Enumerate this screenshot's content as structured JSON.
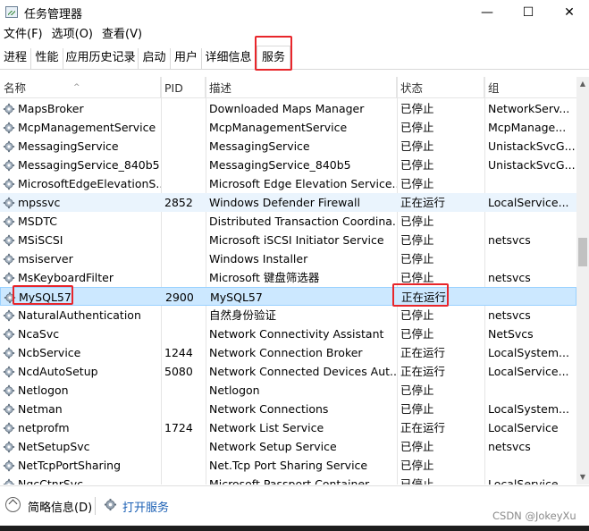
{
  "window": {
    "title": "任务管理器",
    "minimize_glyph": "—",
    "maximize_glyph": "☐",
    "close_glyph": "✕"
  },
  "menu": [
    "文件(F)",
    "选项(O)",
    "查看(V)"
  ],
  "tabs": [
    {
      "label": "进程"
    },
    {
      "label": "性能"
    },
    {
      "label": "应用历史记录"
    },
    {
      "label": "启动"
    },
    {
      "label": "用户"
    },
    {
      "label": "详细信息"
    },
    {
      "label": "服务",
      "active": true
    }
  ],
  "columns": {
    "name": "名称",
    "pid": "PID",
    "description": "描述",
    "status": "状态",
    "group": "组",
    "sort_arrow": "^"
  },
  "services": [
    {
      "name": "MapsBroker",
      "pid": "",
      "description": "Downloaded Maps Manager",
      "status": "已停止",
      "group": "NetworkServ..."
    },
    {
      "name": "McpManagementService",
      "pid": "",
      "description": "McpManagementService",
      "status": "已停止",
      "group": "McpManage..."
    },
    {
      "name": "MessagingService",
      "pid": "",
      "description": "MessagingService",
      "status": "已停止",
      "group": "UnistackSvcG..."
    },
    {
      "name": "MessagingService_840b5",
      "pid": "",
      "description": "MessagingService_840b5",
      "status": "已停止",
      "group": "UnistackSvcG..."
    },
    {
      "name": "MicrosoftEdgeElevationS...",
      "pid": "",
      "description": "Microsoft Edge Elevation Service...",
      "status": "已停止",
      "group": ""
    },
    {
      "name": "mpssvc",
      "pid": "2852",
      "description": "Windows Defender Firewall",
      "status": "正在运行",
      "group": "LocalService...",
      "highlight": true
    },
    {
      "name": "MSDTC",
      "pid": "",
      "description": "Distributed Transaction Coordina...",
      "status": "已停止",
      "group": ""
    },
    {
      "name": "MSiSCSI",
      "pid": "",
      "description": "Microsoft iSCSI Initiator Service",
      "status": "已停止",
      "group": "netsvcs"
    },
    {
      "name": "msiserver",
      "pid": "",
      "description": "Windows Installer",
      "status": "已停止",
      "group": ""
    },
    {
      "name": "MsKeyboardFilter",
      "pid": "",
      "description": "Microsoft 键盘筛选器",
      "status": "已停止",
      "group": "netsvcs"
    },
    {
      "name": "MySQL57",
      "pid": "2900",
      "description": "MySQL57",
      "status": "正在运行",
      "group": "",
      "selected": true
    },
    {
      "name": "NaturalAuthentication",
      "pid": "",
      "description": "自然身份验证",
      "status": "已停止",
      "group": "netsvcs"
    },
    {
      "name": "NcaSvc",
      "pid": "",
      "description": "Network Connectivity Assistant",
      "status": "已停止",
      "group": "NetSvcs"
    },
    {
      "name": "NcbService",
      "pid": "1244",
      "description": "Network Connection Broker",
      "status": "正在运行",
      "group": "LocalSystem..."
    },
    {
      "name": "NcdAutoSetup",
      "pid": "5080",
      "description": "Network Connected Devices Aut...",
      "status": "正在运行",
      "group": "LocalService..."
    },
    {
      "name": "Netlogon",
      "pid": "",
      "description": "Netlogon",
      "status": "已停止",
      "group": ""
    },
    {
      "name": "Netman",
      "pid": "",
      "description": "Network Connections",
      "status": "已停止",
      "group": "LocalSystem..."
    },
    {
      "name": "netprofm",
      "pid": "1724",
      "description": "Network List Service",
      "status": "正在运行",
      "group": "LocalService"
    },
    {
      "name": "NetSetupSvc",
      "pid": "",
      "description": "Network Setup Service",
      "status": "已停止",
      "group": "netsvcs"
    },
    {
      "name": "NetTcpPortSharing",
      "pid": "",
      "description": "Net.Tcp Port Sharing Service",
      "status": "已停止",
      "group": ""
    },
    {
      "name": "NgcCtnrSvc",
      "pid": "",
      "description": "Microsoft Passport Container",
      "status": "已停止",
      "group": "LocalService..."
    }
  ],
  "footer": {
    "less_details": "简略信息(D)",
    "open_services": "打开服务"
  },
  "watermark": "CSDN @JokeyXu",
  "colors": {
    "annotation_red": "#e8262b",
    "selected_row": "#cce8ff",
    "link_blue": "#1a5fb4"
  },
  "icons": {
    "service": "gear-icon",
    "app": "task-manager-icon",
    "collapse": "chevron-up-icon"
  }
}
